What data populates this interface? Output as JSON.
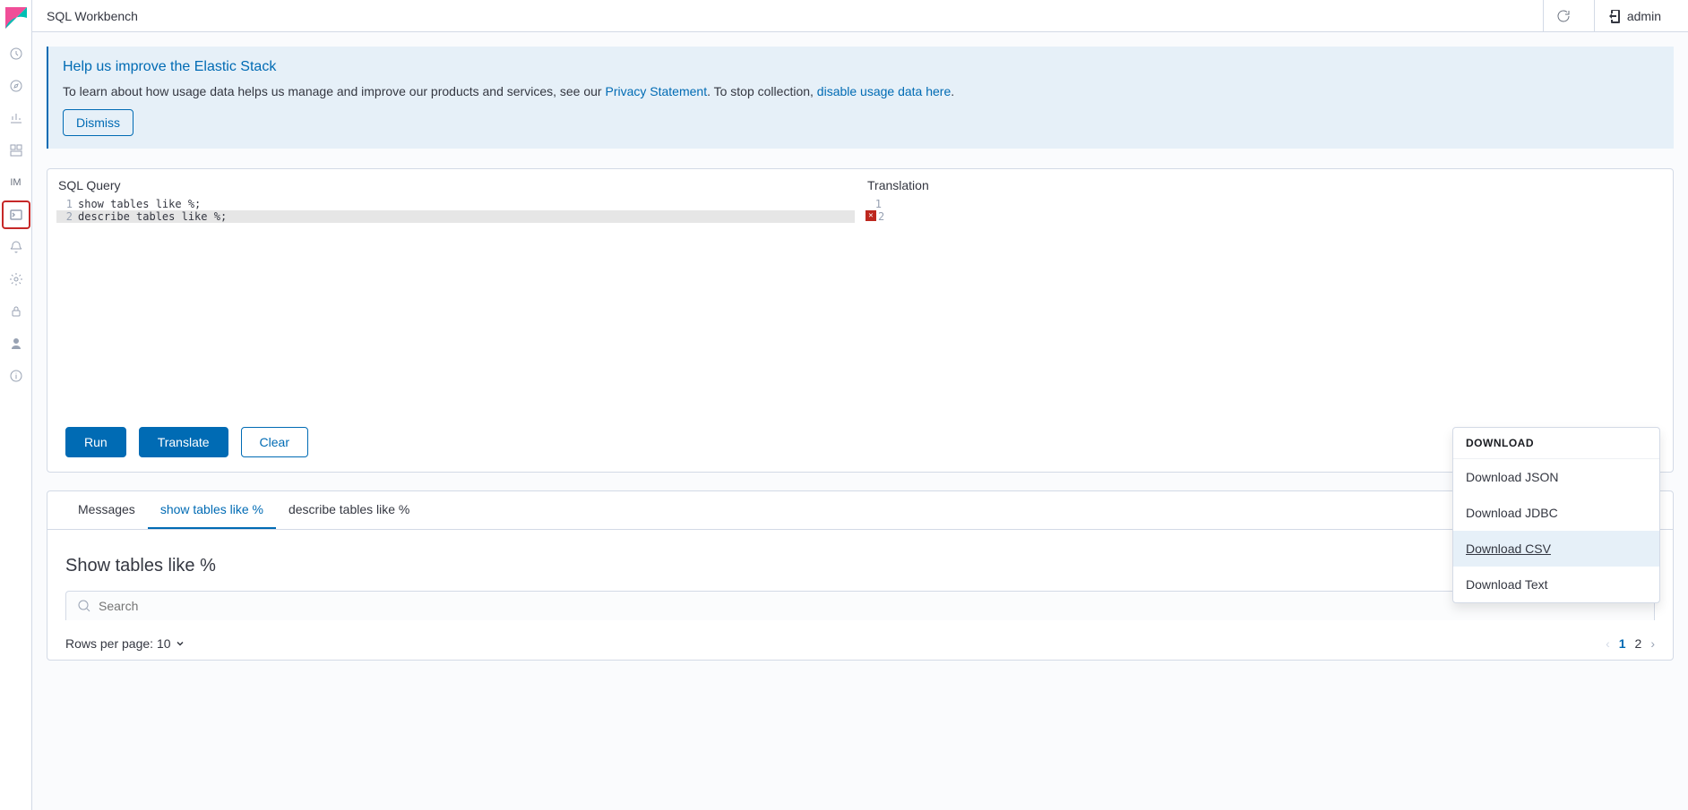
{
  "app_title": "SQL Workbench",
  "user": "admin",
  "sidenav": {
    "im_label": "IM"
  },
  "callout": {
    "title": "Help us improve the Elastic Stack",
    "text_before": "To learn about how usage data helps us manage and improve our products and services, see our ",
    "link1": "Privacy Statement",
    "text_mid": ". To stop collection, ",
    "link2": "disable usage data here",
    "text_after": ".",
    "dismiss": "Dismiss"
  },
  "editor": {
    "sql_label": "SQL Query",
    "translation_label": "Translation",
    "lines": [
      {
        "n": "1",
        "text": "show tables like %;"
      },
      {
        "n": "2",
        "text": "describe tables like %;"
      }
    ],
    "t_lines": [
      {
        "n": "1"
      },
      {
        "n": "2"
      }
    ]
  },
  "actions": {
    "run": "Run",
    "translate": "Translate",
    "clear": "Clear"
  },
  "results": {
    "tabs": [
      {
        "label": "Messages",
        "active": false
      },
      {
        "label": "show tables like %",
        "active": true
      },
      {
        "label": "describe tables like %",
        "active": false
      }
    ],
    "title": "Show tables like %",
    "download_label": "Download",
    "download_menu": {
      "header": "DOWNLOAD",
      "items": [
        {
          "label": "Download JSON",
          "hover": false
        },
        {
          "label": "Download JDBC",
          "hover": false
        },
        {
          "label": "Download CSV",
          "hover": true
        },
        {
          "label": "Download Text",
          "hover": false
        }
      ]
    },
    "search_placeholder": "Search",
    "pagination": {
      "rows_label": "Rows per page: 10",
      "pages": [
        "1",
        "2"
      ],
      "active_page": "1"
    }
  }
}
